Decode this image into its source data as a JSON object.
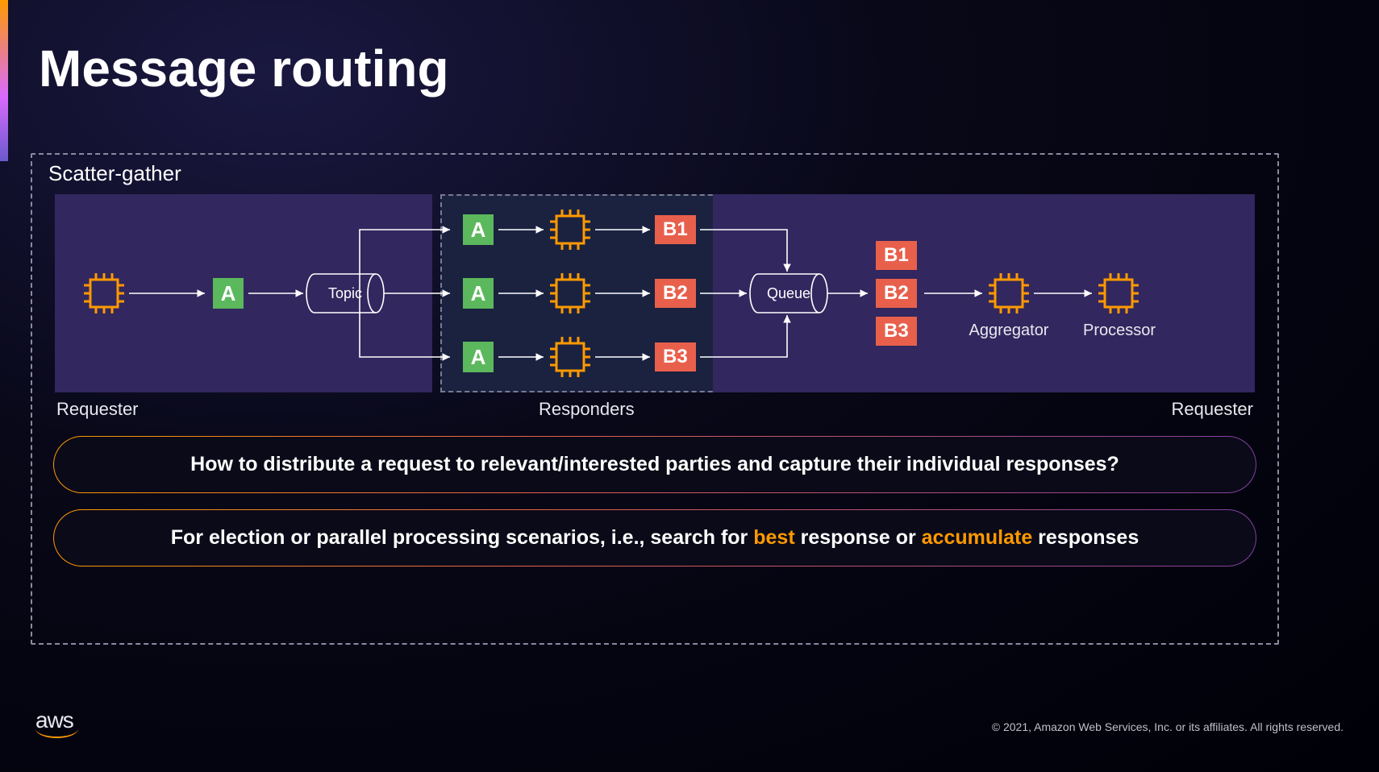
{
  "title": "Message routing",
  "pattern_name": "Scatter-gather",
  "labels": {
    "requester_left": "Requester",
    "responders": "Responders",
    "requester_right": "Requester",
    "topic": "Topic",
    "queue": "Queue",
    "aggregator": "Aggregator",
    "processor": "Processor"
  },
  "messages": {
    "request": "A",
    "responses": [
      "B1",
      "B2",
      "B3"
    ],
    "aggregated": [
      "B1",
      "B2",
      "B3"
    ]
  },
  "callouts": {
    "c1": "How to distribute a request to relevant/interested parties and capture their individual responses?",
    "c2_pre": "For election or parallel processing scenarios, i.e., search for ",
    "c2_hl1": "best",
    "c2_mid": " response or ",
    "c2_hl2": "accumulate",
    "c2_post": " responses"
  },
  "footer": {
    "logo": "aws",
    "copyright": "© 2021, Amazon Web Services, Inc. or its affiliates. All rights reserved."
  },
  "colors": {
    "accent_orange": "#ff9900",
    "msg_green": "#5cb85c",
    "msg_orange": "#e8604c",
    "panel_purple": "#32275e",
    "panel_navy": "#1a2240"
  }
}
